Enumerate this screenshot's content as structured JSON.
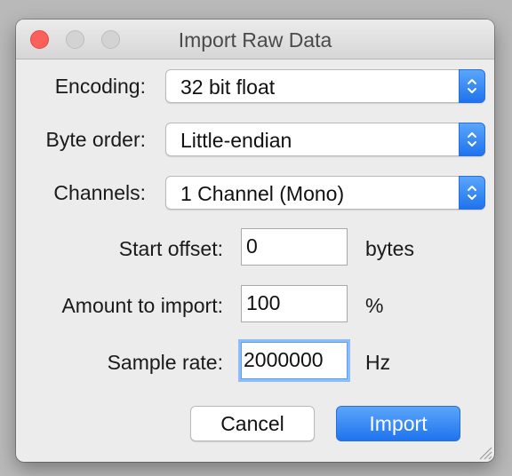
{
  "window": {
    "title": "Import Raw Data"
  },
  "encoding": {
    "label": "Encoding:",
    "value": "32 bit float"
  },
  "byte_order": {
    "label": "Byte order:",
    "value": "Little-endian"
  },
  "channels": {
    "label": "Channels:",
    "value": "1 Channel (Mono)"
  },
  "start_offset": {
    "label": "Start offset:",
    "value": "0",
    "unit": "bytes"
  },
  "amount": {
    "label": "Amount to import:",
    "value": "100",
    "unit": "%"
  },
  "sample_rate": {
    "label": "Sample rate:",
    "value": "2000000",
    "unit": "Hz"
  },
  "buttons": {
    "cancel": "Cancel",
    "import": "Import"
  },
  "colors": {
    "accent": "#2a7cf0",
    "close": "#fc605c"
  }
}
